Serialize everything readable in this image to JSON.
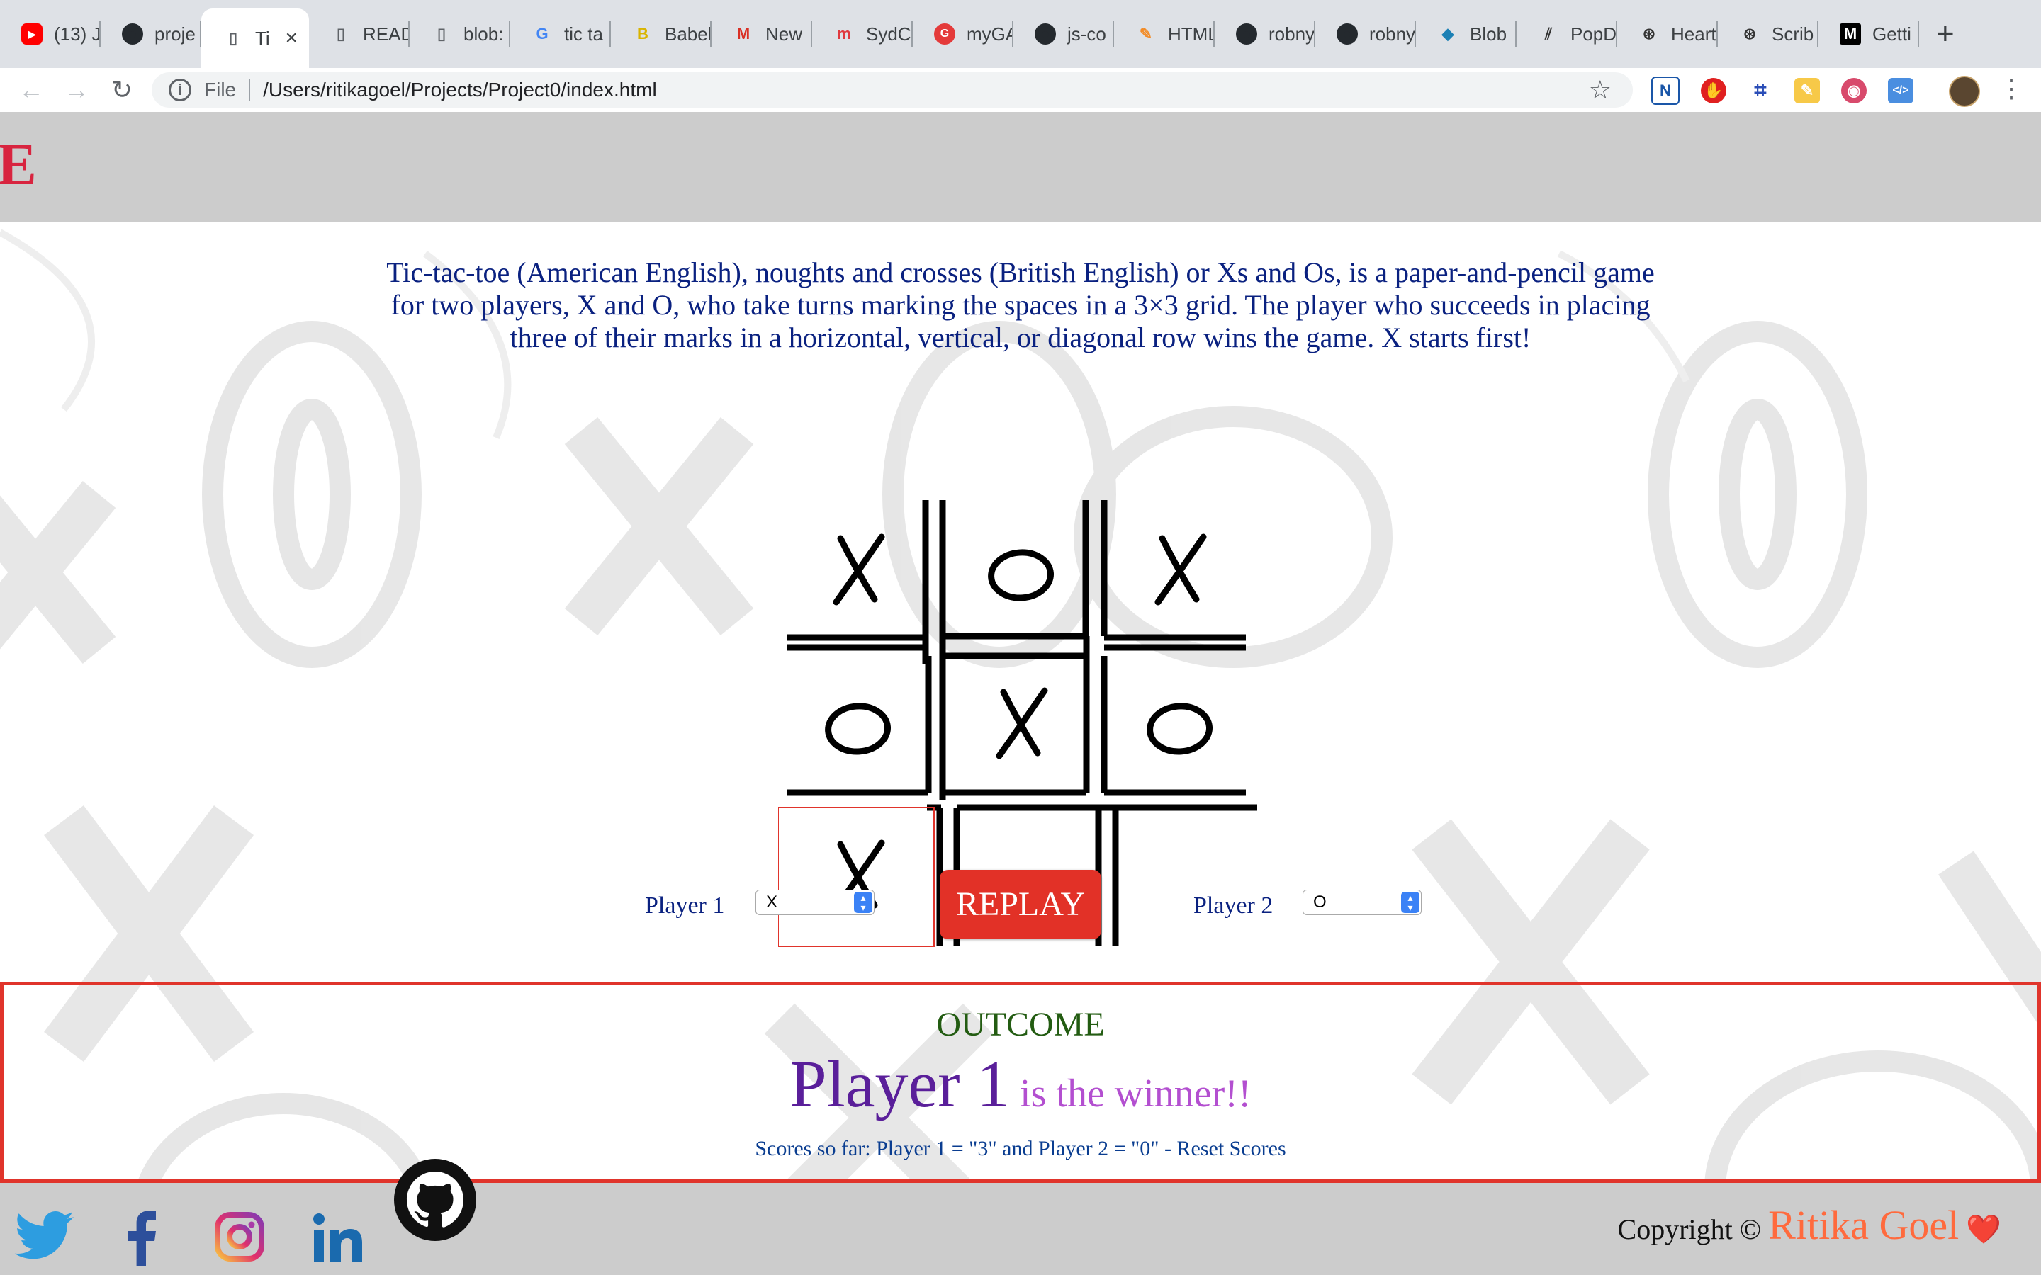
{
  "browser": {
    "tabs": [
      {
        "label": "(13) J",
        "icon": "youtube-icon",
        "color": "#ff0000"
      },
      {
        "label": "proje",
        "icon": "github-icon",
        "color": "#24292e"
      },
      {
        "label": "Ti",
        "icon": "document-icon",
        "color": "#5f6368",
        "active": true
      },
      {
        "label": "READ",
        "icon": "document-icon",
        "color": "#5f6368"
      },
      {
        "label": "blob:",
        "icon": "document-icon",
        "color": "#5f6368"
      },
      {
        "label": "tic ta",
        "icon": "google-icon",
        "color": "#4285f4"
      },
      {
        "label": "Babel",
        "icon": "babel-icon",
        "color": "#d9b400"
      },
      {
        "label": "New",
        "icon": "gmail-icon",
        "color": "#d93025"
      },
      {
        "label": "SydC",
        "icon": "meetup-icon",
        "color": "#e0393e"
      },
      {
        "label": "myGA",
        "icon": "ga-icon",
        "color": "#e43a3a"
      },
      {
        "label": "js-co",
        "icon": "github-icon",
        "color": "#24292e"
      },
      {
        "label": "HTML",
        "icon": "codepen-icon",
        "color": "#f28c28"
      },
      {
        "label": "robny",
        "icon": "github-icon",
        "color": "#24292e"
      },
      {
        "label": "robny",
        "icon": "github-icon",
        "color": "#24292e"
      },
      {
        "label": "Blob",
        "icon": "blob-icon",
        "color": "#1b80b5"
      },
      {
        "label": "PopD",
        "icon": "popd-icon",
        "color": "#333333"
      },
      {
        "label": "Heart",
        "icon": "scribd-icon",
        "color": "#333333"
      },
      {
        "label": "Scrib",
        "icon": "scribd-icon",
        "color": "#333333"
      },
      {
        "label": "Getti",
        "icon": "medium-icon",
        "color": "#000000"
      }
    ],
    "new_tab_label": "+",
    "address": {
      "scheme_label": "File",
      "url": "/Users/ritikagoel/Projects/Project0/index.html"
    }
  },
  "header": {
    "title": "TOE"
  },
  "intro_text": "Tic-tac-toe (American English), noughts and crosses (British English) or Xs and Os, is a paper-and-pencil game for two players, X and O, who take turns marking the spaces in a 3×3 grid. The player who succeeds in placing three of their marks in a horizontal, vertical, or diagonal row wins the game. X starts first!",
  "board": {
    "cells": [
      "X",
      "O",
      "X",
      "O",
      "X",
      "O",
      "X",
      "",
      ""
    ],
    "highlighted_cell": 6
  },
  "controls": {
    "player1_label": "Player 1",
    "player1_value": "X",
    "replay_label": "REPLAY",
    "player2_label": "Player 2",
    "player2_value": "O"
  },
  "outcome": {
    "title": "OUTCOME",
    "winner_player": "Player 1",
    "winner_suffix": "is the winner!!",
    "scores_text": "Scores so far: Player 1 = \"3\" and Player 2 = \"0\" - Reset Scores"
  },
  "footer": {
    "copyright_prefix": "Copyright ©",
    "author": "Ritika Goel",
    "heart": "❤️",
    "social": [
      "twitter-icon",
      "facebook-icon",
      "instagram-icon",
      "linkedin-icon",
      "github-icon"
    ]
  },
  "colors": {
    "title_red": "#d8243f",
    "replay_red": "#e23127",
    "outcome_border": "#e0342b",
    "intro_navy": "#0a2180"
  }
}
